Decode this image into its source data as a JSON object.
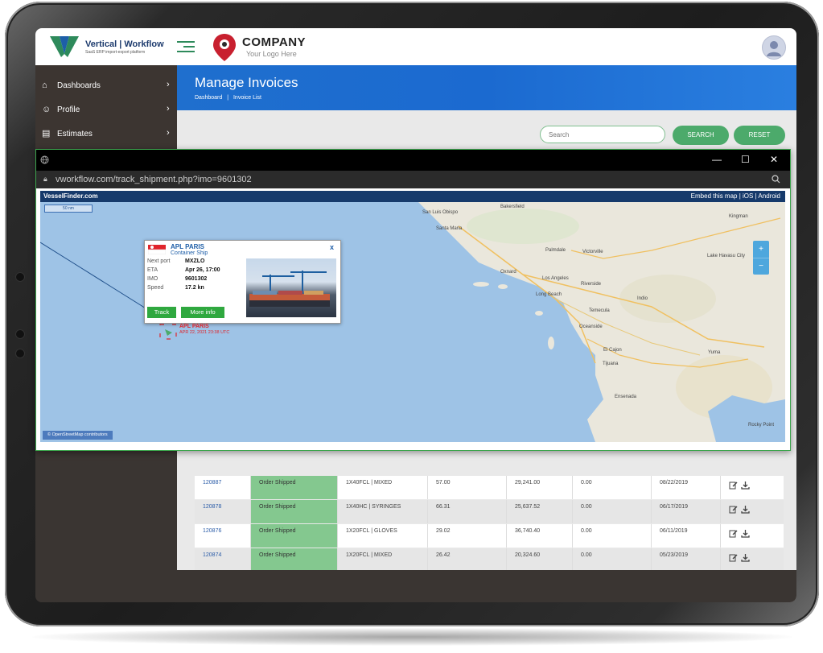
{
  "brand": {
    "name": "Vertical | Workflow",
    "tagline": "SaaS ERP import-export platform",
    "accent": "#2e8a5b"
  },
  "company": {
    "name": "COMPANY",
    "tagline": "Your Logo Here"
  },
  "sidebar": {
    "items": [
      {
        "label": "Dashboards",
        "icon": "home-icon"
      },
      {
        "label": "Profile",
        "icon": "users-icon"
      },
      {
        "label": "Estimates",
        "icon": "estimates-icon"
      }
    ]
  },
  "page": {
    "title": "Manage Invoices",
    "breadcrumb": [
      "Dashboard",
      "|",
      "Invoice List"
    ]
  },
  "search": {
    "placeholder": "Search",
    "search_label": "SEARCH",
    "reset_label": "RESET"
  },
  "popup": {
    "url": "vworkflow.com/track_shipment.php?imo=9601302",
    "controls": [
      "—",
      "☐",
      "✕"
    ]
  },
  "map": {
    "brand": "VesselFinder.com",
    "links": "Embed this map  |  iOS  |  Android",
    "scale": "50 nm",
    "attribution": "© OpenStreetMap contributors",
    "zoom_in": "+",
    "zoom_out": "−",
    "places": [
      "San Luis Obispo",
      "Bakersfield",
      "Kingman",
      "Santa Maria",
      "Palmdale",
      "Victorville",
      "Lake Havasu City",
      "Oxnard",
      "Los Angeles",
      "Riverside",
      "Long Beach",
      "Indio",
      "Temecula",
      "Oceanside",
      "El Cajon",
      "Tijuana",
      "Yuma",
      "Ensenada",
      "Rocky Point"
    ]
  },
  "vessel": {
    "name": "APL PARIS",
    "type": "Container Ship",
    "fields": [
      {
        "key": "Next port",
        "value": "MXZLO"
      },
      {
        "key": "ETA",
        "value": "Apr 26, 17:00"
      },
      {
        "key": "IMO",
        "value": "9601302"
      },
      {
        "key": "Speed",
        "value": "17.2 kn"
      }
    ],
    "track_label": "Track",
    "more_label": "More info",
    "map_label": "APL PARIS",
    "map_time": "APR 22, 2021 23:38 UTC",
    "flag_color": "#e0242b"
  },
  "invoices": [
    {
      "id": "120887",
      "status": "Order Shipped",
      "container": "1X40FCL | MIXED",
      "weight": "57.00",
      "amount": "29,241.00",
      "other": "0.00",
      "date": "08/22/2019"
    },
    {
      "id": "120878",
      "status": "Order Shipped",
      "container": "1X40HC | SYRINGES",
      "weight": "66.31",
      "amount": "25,637.52",
      "other": "0.00",
      "date": "06/17/2019"
    },
    {
      "id": "120876",
      "status": "Order Shipped",
      "container": "1X20FCL | GLOVES",
      "weight": "29.02",
      "amount": "36,740.40",
      "other": "0.00",
      "date": "06/11/2019"
    },
    {
      "id": "120874",
      "status": "Order Shipped",
      "container": "1X20FCL | MIXED",
      "weight": "26.42",
      "amount": "20,324.60",
      "other": "0.00",
      "date": "05/23/2019"
    }
  ]
}
